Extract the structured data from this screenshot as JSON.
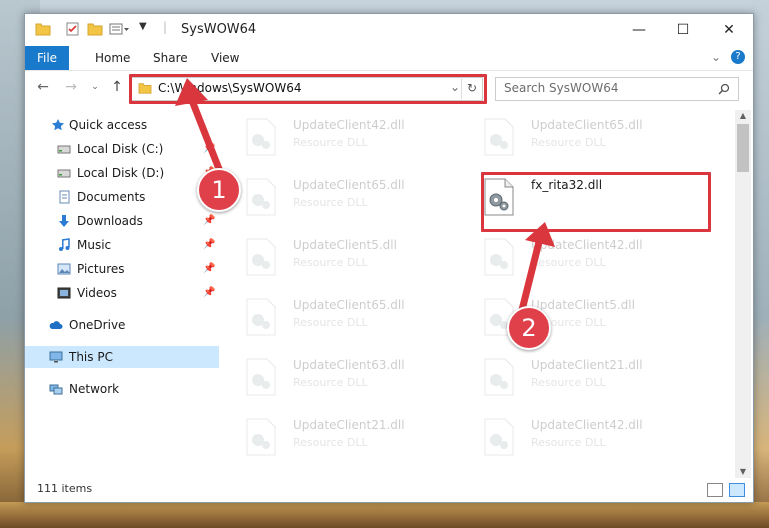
{
  "window": {
    "title": "SysWOW64"
  },
  "ribbon": {
    "tabs": [
      "File",
      "Home",
      "Share",
      "View"
    ]
  },
  "nav": {
    "address": "C:\\Windows\\SysWOW64",
    "search_placeholder": "Search SysWOW64"
  },
  "sidebar": {
    "items": [
      {
        "label": "Quick access",
        "icon": "star-icon",
        "pinned": false
      },
      {
        "label": "Local Disk (C:)",
        "icon": "drive-icon",
        "pinned": true
      },
      {
        "label": "Local Disk (D:)",
        "icon": "drive-icon",
        "pinned": true
      },
      {
        "label": "Documents",
        "icon": "documents-icon",
        "pinned": true
      },
      {
        "label": "Downloads",
        "icon": "download-icon",
        "pinned": true
      },
      {
        "label": "Music",
        "icon": "music-icon",
        "pinned": true
      },
      {
        "label": "Pictures",
        "icon": "pictures-icon",
        "pinned": true
      },
      {
        "label": "Videos",
        "icon": "videos-icon",
        "pinned": true
      },
      {
        "label": "OneDrive",
        "icon": "cloud-icon",
        "pinned": false
      },
      {
        "label": "This PC",
        "icon": "computer-icon",
        "pinned": false,
        "selected": true
      },
      {
        "label": "Network",
        "icon": "network-icon",
        "pinned": false
      }
    ]
  },
  "files": [
    {
      "name": "UpdateClient42.dll",
      "type": "Resource DLL",
      "highlight": false
    },
    {
      "name": "UpdateClient65.dll",
      "type": "Resource DLL",
      "highlight": false
    },
    {
      "name": "UpdateClient65.dll",
      "type": "Resource DLL",
      "highlight": false
    },
    {
      "name": "fx_rita32.dll",
      "type": "",
      "highlight": true
    },
    {
      "name": "UpdateClient5.dll",
      "type": "Resource DLL",
      "highlight": false
    },
    {
      "name": "UpdateClient42.dll",
      "type": "Resource DLL",
      "highlight": false
    },
    {
      "name": "UpdateClient65.dll",
      "type": "Resource DLL",
      "highlight": false
    },
    {
      "name": "UpdateClient5.dll",
      "type": "Resource DLL",
      "highlight": false
    },
    {
      "name": "UpdateClient63.dll",
      "type": "Resource DLL",
      "highlight": false
    },
    {
      "name": "UpdateClient21.dll",
      "type": "Resource DLL",
      "highlight": false
    },
    {
      "name": "UpdateClient21.dll",
      "type": "Resource DLL",
      "highlight": false
    },
    {
      "name": "UpdateClient42.dll",
      "type": "Resource DLL",
      "highlight": false
    }
  ],
  "status": {
    "item_count": "111 items"
  },
  "annotations": {
    "step1": "1",
    "step2": "2",
    "color": "#d9363e"
  }
}
